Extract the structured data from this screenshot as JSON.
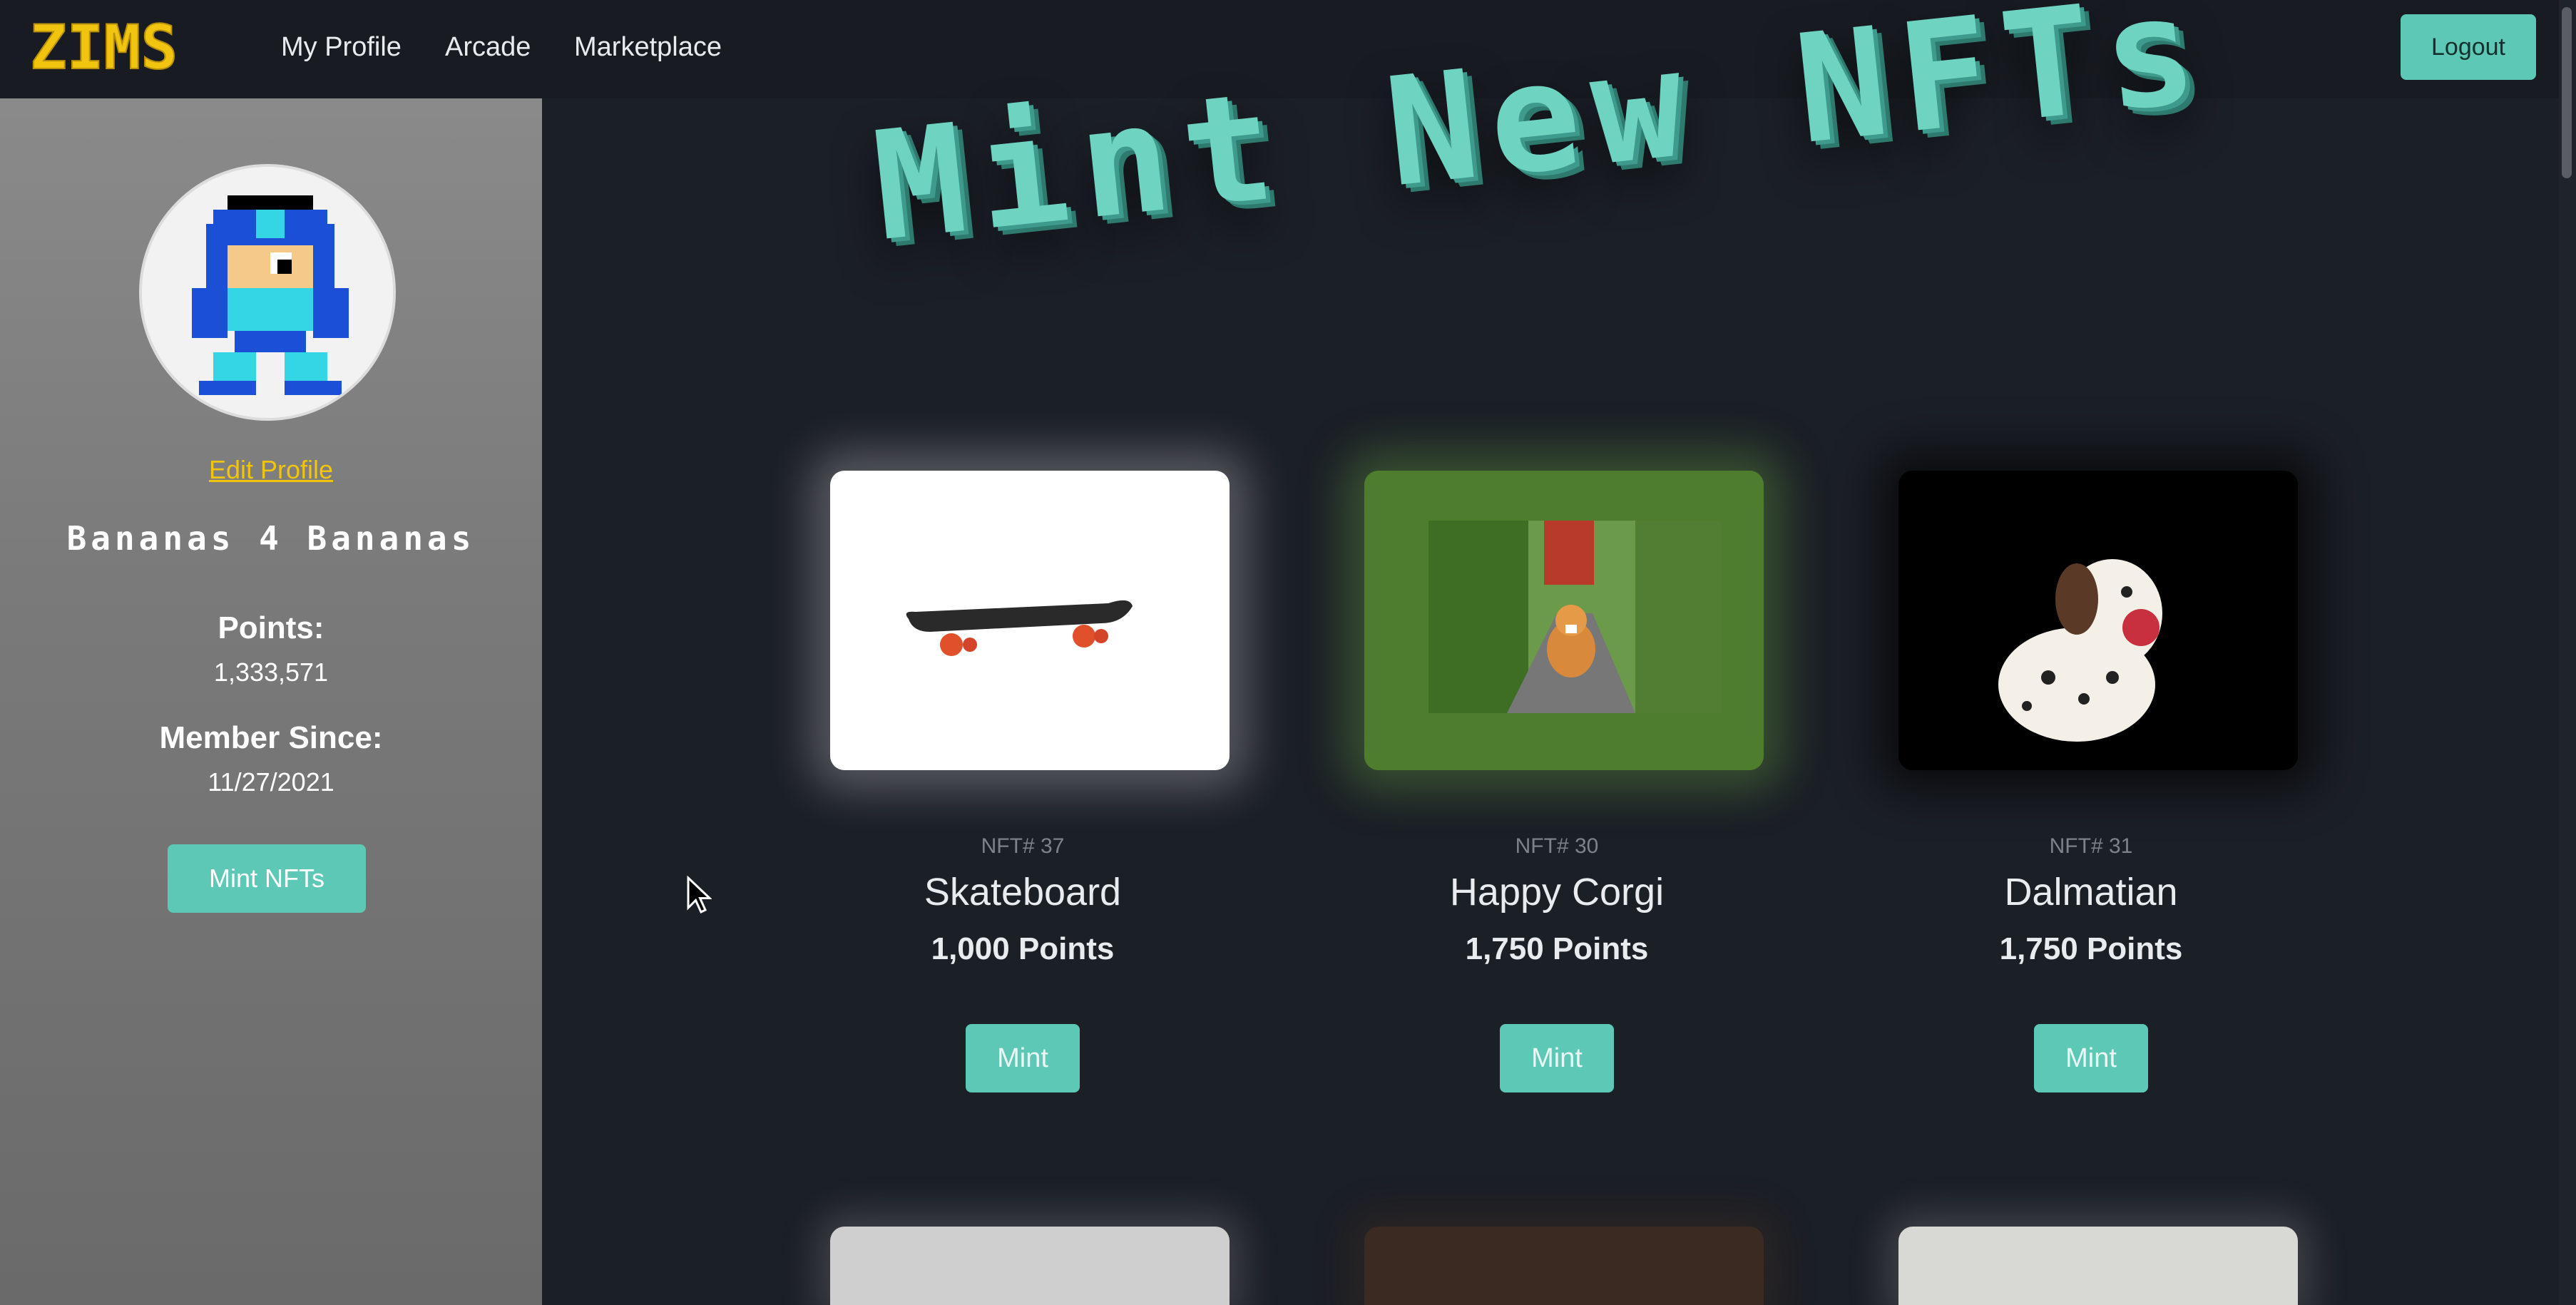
{
  "nav": {
    "logo": "ZIMS",
    "links": [
      "My Profile",
      "Arcade",
      "Marketplace"
    ],
    "logout_label": "Logout"
  },
  "sidebar": {
    "edit_profile_label": "Edit Profile",
    "username": "Bananas 4 Bananas",
    "points_label": "Points:",
    "points_value": "1,333,571",
    "member_since_label": "Member Since:",
    "member_since_value": "11/27/2021",
    "mint_button_label": "Mint NFTs"
  },
  "main": {
    "title": "Mint New NFTs",
    "cards": [
      {
        "number": "NFT# 37",
        "name": "Skateboard",
        "points": "1,000 Points",
        "button": "Mint"
      },
      {
        "number": "NFT# 30",
        "name": "Happy Corgi",
        "points": "1,750 Points",
        "button": "Mint"
      },
      {
        "number": "NFT# 31",
        "name": "Dalmatian",
        "points": "1,750 Points",
        "button": "Mint"
      }
    ]
  },
  "colors": {
    "accent": "#5ec8b7",
    "logo": "#f1c40f",
    "background": "#1b1f26",
    "sidebar": "#7a7a7a"
  },
  "icons": [
    "megaman-avatar-icon",
    "mouse-cursor-icon"
  ]
}
